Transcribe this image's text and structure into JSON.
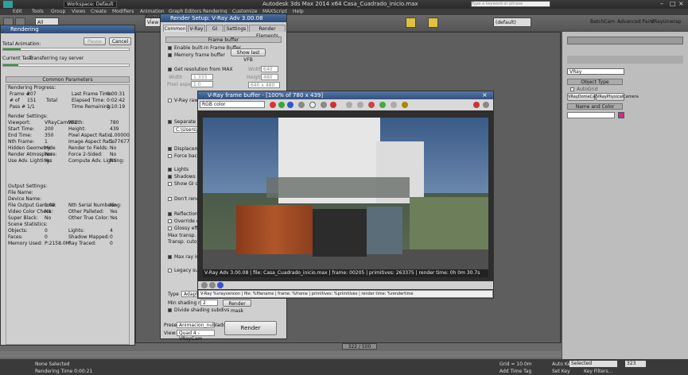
{
  "app": {
    "title": "Autodesk 3ds Max  2014 x64    Casa_Cuadrado_inicio.max",
    "workspace": "Workspace: Default",
    "search_placeholder": "Type a keyword or phrase"
  },
  "menu": [
    "Edit",
    "Tools",
    "Group",
    "Views",
    "Create",
    "Modifiers",
    "Animation",
    "Graph Editors",
    "Rendering",
    "Customize",
    "MAXScript",
    "Help"
  ],
  "toolbar": {
    "view": "View",
    "all": "All",
    "named_sel": "(default)",
    "batch": "BatchCam",
    "advanced_paint": "Advanced Paint",
    "vray_unwrap": "VRayUnwrap",
    "populate": "Popula"
  },
  "rendering_window": {
    "title": "Rendering",
    "pause": "Pause",
    "cancel": "Cancel",
    "total_animation": "Total Animation:",
    "current_task": "Current Task:",
    "task_value": "Transferring ray server",
    "common_parameters": "Common Parameters",
    "progress_header": "Rendering Progress:",
    "frame_label": "Frame #",
    "frame_value": "207",
    "last_frame_label": "Last Frame Time:",
    "last_frame_value": "0:00:31",
    "of_label": "# of",
    "of_value": "151",
    "total_label": "Total",
    "elapsed_label": "Elapsed Time:",
    "elapsed_value": "0:02:42",
    "pass_label": "Pass #",
    "pass_value": "1/1",
    "remaining_label": "Time Remaining:",
    "remaining_value": "1:10:19",
    "settings_header": "Render Settings:",
    "settings": [
      [
        "Viewport:",
        "VRayCam001",
        "Width:",
        "780"
      ],
      [
        "Start Time:",
        "200",
        "Height:",
        "439"
      ],
      [
        "End Time:",
        "350",
        "Pixel Aspect Ratio:",
        "1.00000"
      ],
      [
        "Nth Frame:",
        "1",
        "Image Aspect Ratio:",
        "1.77677"
      ],
      [
        "Hidden Geometry:",
        "Hide",
        "Render to Fields:",
        "No"
      ],
      [
        "Render Atmosphere:",
        "Yes",
        "Force 2-Sided:",
        "No"
      ],
      [
        "Use Adv. Lighting:",
        "Yes",
        "Compute Adv. Lighting:",
        "No"
      ]
    ],
    "output_header": "Output Settings:",
    "output": [
      [
        "File Name:",
        "",
        "",
        ""
      ],
      [
        "Device Name:",
        "",
        "",
        ""
      ],
      [
        "File Output Gamma:",
        "1.00",
        "Nth Serial Numbering:",
        "No"
      ],
      [
        "Video Color Check:",
        "No",
        "Other Palleted:",
        "Yes"
      ],
      [
        "Super Black:",
        "No",
        "Other True Color:",
        "Yes"
      ]
    ],
    "scene_header": "Scene Statistics:",
    "scene": [
      [
        "Objects:",
        "0",
        "Lights:",
        "4"
      ],
      [
        "Faces:",
        "0",
        "Shadow Mapped:",
        "0"
      ],
      [
        "Memory Used:",
        "P:2158.0M",
        "Ray Traced:",
        "0"
      ]
    ]
  },
  "render_setup": {
    "title": "Render Setup: V-Ray Adv 3.00.08",
    "tabs": [
      "Common",
      "V-Ray",
      "GI",
      "Settings",
      "Render Elements"
    ],
    "frame_buffer": "Frame buffer",
    "enable_builtin": "Enable built-in Frame Buffer",
    "memory_fb": "Memory frame buffer",
    "show_last_vfb": "Show last VFB",
    "get_res": "Get resolution from MAX",
    "width_lbl": "Width",
    "width_val": "640",
    "height_lbl": "Height",
    "height_val": "480",
    "res_preset": "640 x 480",
    "image_aspect": "Image aspect",
    "aspect_val": "1.333",
    "pixel_aspect": "Pixel aspect",
    "pixel_val": "1.0",
    "vray_raw": "V-Ray raw image file",
    "separate": "Separate render channels",
    "path": "C:\\Users\\gp",
    "displacement": "Displacement",
    "force_back": "Force back face culling",
    "lights": "Lights",
    "shadows": "Shadows",
    "show_gi": "Show GI only",
    "dont_render": "Don't render final image",
    "reflection": "Reflection/refraction",
    "override_depth": "Override depth",
    "glossy": "Glossy effects",
    "max_transp": "Max transp. levels",
    "transp_cutoff": "Transp. cutoff",
    "max_ray": "Max ray intens.",
    "legacy": "Legacy sun/sky/camera models",
    "type_lbl": "Type",
    "type_val": "Adaptive",
    "min_shading": "Min shading rate",
    "min_val": "2",
    "render_mask": "Render mask",
    "divide": "Divide shading subdivs",
    "preset_lbl": "Preset:",
    "preset_val": "Animacion_nublado",
    "view_lbl": "View:",
    "view_val": "Quad 4 - VRayCam",
    "render_btn": "Render"
  },
  "vfb": {
    "title": "V-Ray frame buffer - [100% of 780 x 439]",
    "channel": "RGB color",
    "status": "V-Ray Adv 3.00.08 | file: Casa_Cuadrado_inicio.max | frame: 00205 | primitives: 263375 | render time: 0h 0m 30.7s",
    "stamp": "V-Ray %vrayversion | file: %filename | frame: %frame | primitives: %primitives | render time: %rendertime"
  },
  "right_panel": {
    "renderer": "VRay",
    "object_type": "Object Type",
    "autogrid": "AutoGrid",
    "buttons": [
      "VRayDomeCamera",
      "VRayPhysicalCamera"
    ],
    "name_color": "Name and Color"
  },
  "timeline": {
    "frame": "322 / 500",
    "ticks": [
      "80",
      "90",
      "100",
      "110",
      "120",
      "130",
      "140",
      "150",
      "160",
      "170",
      "180",
      "190",
      "200",
      "210",
      "220",
      "230",
      "240",
      "250",
      "260",
      "270",
      "280",
      "290",
      "300"
    ]
  },
  "status": {
    "none_selected": "None Selected",
    "rendering_time": "Rendering Time 0:00:21",
    "grid": "Grid = 10.0m",
    "add_time_tag": "Add Time Tag",
    "autokey": "Auto Key",
    "autokey_val": "Selected",
    "setkey": "Set Key",
    "key_filters": "Key Filters...",
    "frame_field": "323",
    "x_lbl": "X:",
    "y_lbl": "Y:",
    "z_lbl": "Z:"
  },
  "colors": {
    "accent": "#2c4a78",
    "swatch": "#d02a8a",
    "progress": "#2a9a3a"
  }
}
